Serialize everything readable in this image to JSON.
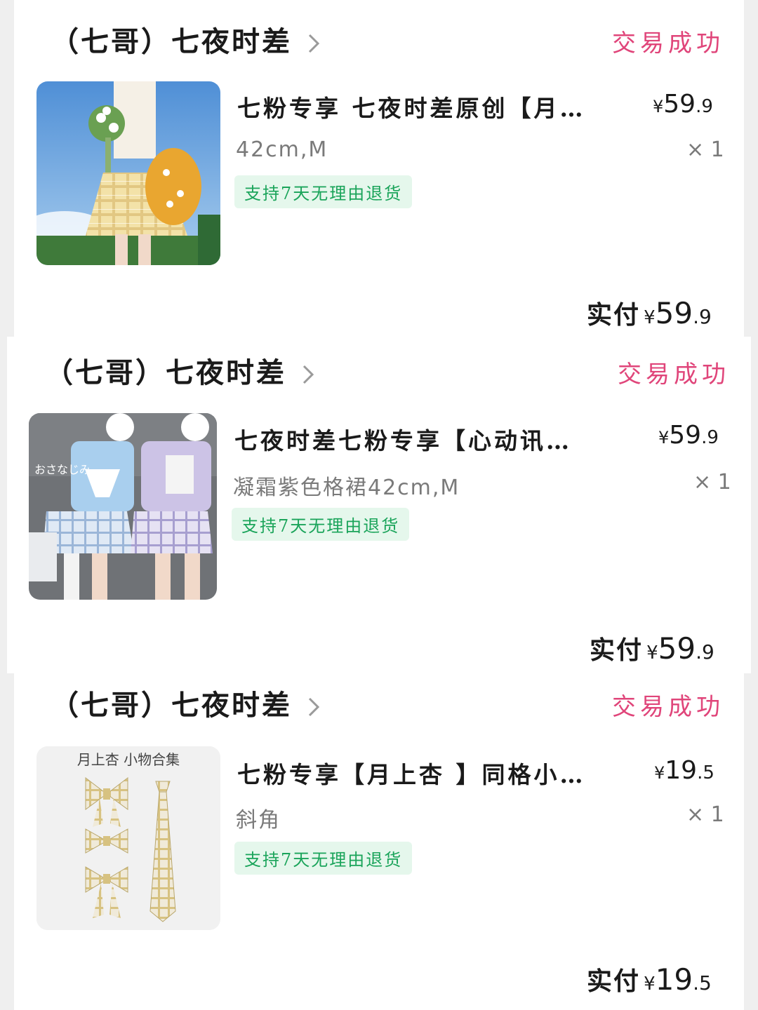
{
  "orders": [
    {
      "shop_name": "（七哥）七夜时差",
      "status": "交易成功",
      "item": {
        "title": "七粉专享 七夜时差原创【月…",
        "sku": "42cm,M",
        "price_symbol": "¥",
        "price_int": "59",
        "price_dec": ".9",
        "qty": "× 1",
        "tag": "支持7天无理由退货",
        "image_icon": "product-photo-plaid-skirt"
      },
      "paid_label": "实付",
      "paid_symbol": "¥",
      "paid_int": "59",
      "paid_dec": ".9"
    },
    {
      "shop_name": "（七哥）七夜时差",
      "status": "交易成功",
      "item": {
        "title": "七夜时差七粉专享【心动讯…",
        "sku": "凝霜紫色格裙42cm,M",
        "price_symbol": "¥",
        "price_int": "59",
        "price_dec": ".9",
        "qty": "× 1",
        "tag": "支持7天无理由退货",
        "image_text": "おさなじみ",
        "image_icon": "product-photo-two-girls"
      },
      "paid_label": "实付",
      "paid_symbol": "¥",
      "paid_int": "59",
      "paid_dec": ".9"
    },
    {
      "shop_name": "（七哥）七夜时差",
      "status": "交易成功",
      "item": {
        "title": "七粉专享【月上杏 】同格小…",
        "sku": "斜角",
        "price_symbol": "¥",
        "price_int": "19",
        "price_dec": ".5",
        "qty": "× 1",
        "tag": "支持7天无理由退货",
        "image_text": "月上杏 小物合集",
        "image_icon": "product-photo-bows-and-tie"
      },
      "paid_label": "实付",
      "paid_symbol": "¥",
      "paid_int": "19",
      "paid_dec": ".5"
    }
  ],
  "colors": {
    "status": "#e0457a",
    "tag_bg": "#e5f7ec",
    "tag_text": "#1aa45a",
    "secondary_text": "#7a7a7a"
  }
}
